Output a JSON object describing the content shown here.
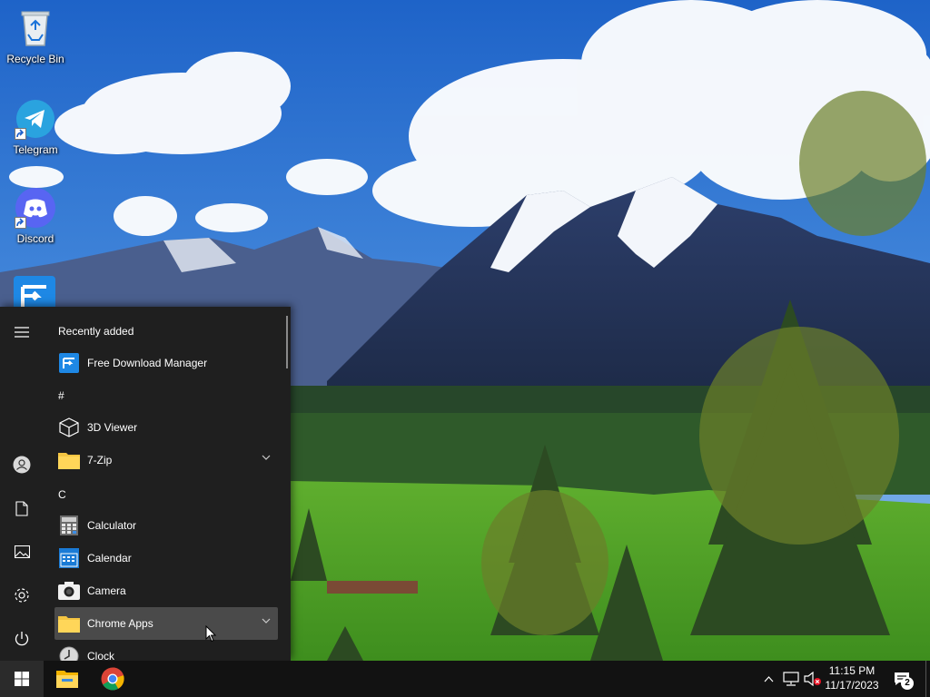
{
  "desktop": {
    "icons": [
      {
        "label": "Recycle Bin",
        "icon": "recycle-bin-icon"
      },
      {
        "label": "Telegram",
        "icon": "telegram-icon"
      },
      {
        "label": "Discord",
        "icon": "discord-icon"
      }
    ]
  },
  "start_menu": {
    "recently_added_header": "Recently added",
    "group_hash": "#",
    "group_c": "C",
    "apps": [
      {
        "name": "Free Download Manager",
        "icon": "fdm-icon"
      },
      {
        "name": "3D Viewer",
        "icon": "cube-icon"
      },
      {
        "name": "7-Zip",
        "icon": "folder-icon",
        "expandable": true
      },
      {
        "name": "Calculator",
        "icon": "calculator-icon"
      },
      {
        "name": "Calendar",
        "icon": "calendar-icon"
      },
      {
        "name": "Camera",
        "icon": "camera-icon"
      },
      {
        "name": "Chrome Apps",
        "icon": "folder-icon",
        "expandable": true,
        "hovered": true
      },
      {
        "name": "Clock",
        "icon": "clock-icon"
      }
    ],
    "rail": [
      "hamburger-icon",
      "user-icon",
      "documents-icon",
      "pictures-icon",
      "settings-icon",
      "power-icon"
    ]
  },
  "taskbar": {
    "pinned": [
      "file-explorer-icon",
      "chrome-icon"
    ],
    "tray": [
      "chevron-up-icon",
      "network-icon",
      "volume-muted-icon"
    ],
    "time": "11:15 PM",
    "date": "11/17/2023",
    "notification_count": "2"
  },
  "colors": {
    "menu_bg": "#1f1f1f",
    "taskbar_bg": "#121212",
    "hover_bg": "#4a4a4a",
    "folder": "#f4c542"
  }
}
